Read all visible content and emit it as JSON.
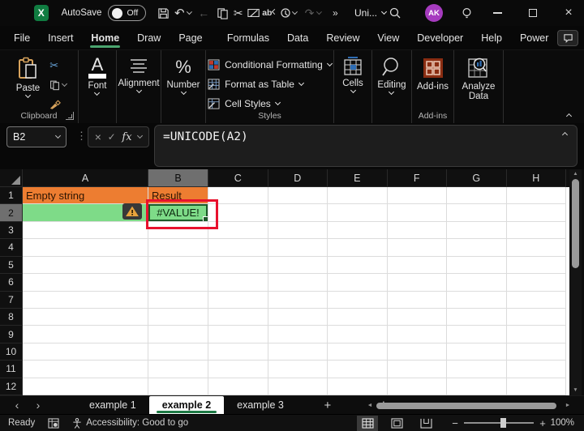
{
  "colors": {
    "excel_green": "#107C41",
    "header_fill_orange": "#ED7D31",
    "cell_fill_green": "#7EDB88",
    "annotation_red": "#E8112D",
    "avatar_purple": "#A63BBF",
    "selection_green": "#1C5A28"
  },
  "title_bar": {
    "autosave_label": "AutoSave",
    "autosave_state": "Off",
    "doc_title": "Uni...",
    "avatar_initials": "AK"
  },
  "menu_bar": {
    "items": [
      "File",
      "Insert",
      "Home",
      "Draw",
      "Page Layout",
      "Formulas",
      "Data",
      "Review",
      "View",
      "Developer",
      "Help",
      "Power Pivot"
    ],
    "active": "Home"
  },
  "ribbon": {
    "paste_label": "Paste",
    "clipboard_group_label": "Clipboard",
    "font_label": "Font",
    "alignment_label": "Alignment",
    "number_label": "Number",
    "conditional_formatting_label": "Conditional Formatting",
    "format_as_table_label": "Format as Table",
    "cell_styles_label": "Cell Styles",
    "styles_group_label": "Styles",
    "cells_label": "Cells",
    "editing_label": "Editing",
    "addins_label": "Add-ins",
    "addins_group_label": "Add-ins",
    "analyze_data_label_line1": "Analyze",
    "analyze_data_label_line2": "Data"
  },
  "formula_bar": {
    "name_box_value": "B2",
    "formula": "=UNICODE(A2)"
  },
  "grid": {
    "columns": [
      "A",
      "B",
      "C",
      "D",
      "E",
      "F",
      "G",
      "H"
    ],
    "rows": [
      "1",
      "2",
      "3",
      "4",
      "5",
      "6",
      "7",
      "8",
      "9",
      "10",
      "11",
      "12"
    ],
    "selected_column": "B",
    "selected_row": "2",
    "active_cell": "B2",
    "cells": {
      "A1": "Empty string",
      "B1": "Result",
      "B2": "#VALUE!"
    },
    "cell_styles": {
      "A1": "orange",
      "B1": "orange",
      "A2": "green",
      "B2": "green selected center"
    }
  },
  "sheet_tabs": {
    "tabs": [
      "example 1",
      "example 2",
      "example 3"
    ],
    "active": "example 2"
  },
  "status_bar": {
    "mode": "Ready",
    "accessibility": "Accessibility: Good to go",
    "zoom_level": "100%"
  },
  "icons": {
    "undo_glyph": "↶",
    "redo_glyph": "↷",
    "back_glyph": "←",
    "cut_glyph": "✂",
    "replace_glyph": "ab",
    "overflow_glyph": "»",
    "close_glyph": "×",
    "cancel_glyph": "×",
    "enter_glyph": "✓",
    "fx_glyph": "fx",
    "font_glyph": "A",
    "percent_glyph": "%",
    "dots_glyph": "⋮",
    "more_glyph": "⋮",
    "add_glyph": "+",
    "nav_left_glyph": "‹",
    "nav_right_glyph": "›",
    "scroll_up_glyph": "▲",
    "scroll_down_glyph": "▼",
    "scroll_left_glyph": "◄",
    "scroll_right_glyph": "►",
    "zoom_minus_glyph": "−",
    "zoom_plus_glyph": "+"
  }
}
